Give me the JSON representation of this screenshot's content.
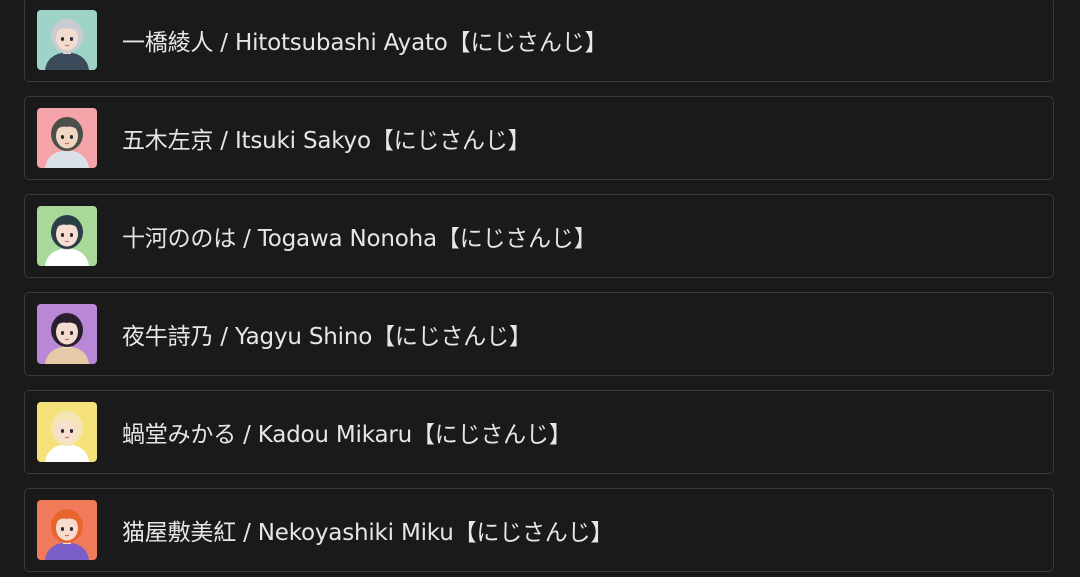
{
  "items": [
    {
      "label": "一橋綾人 / Hitotsubashi Ayato【にじさんじ】",
      "avatar": "avatar-hitotsubashi-ayato",
      "bg": "#9fd3c7",
      "hair": "#c9cdd2",
      "skin": "#f3dccd",
      "accent": "#3b4a5a"
    },
    {
      "label": "五木左京 / Itsuki Sakyo【にじさんじ】",
      "avatar": "avatar-itsuki-sakyo",
      "bg": "#f4a3a8",
      "hair": "#4a4f4a",
      "skin": "#f2d6c4",
      "accent": "#d9e0e6"
    },
    {
      "label": "十河ののは / Togawa Nonoha【にじさんじ】",
      "avatar": "avatar-togawa-nonoha",
      "bg": "#a8d89a",
      "hair": "#2c3e45",
      "skin": "#f6dfd2",
      "accent": "#ffffff"
    },
    {
      "label": "夜牛詩乃 / Yagyu Shino【にじさんじ】",
      "avatar": "avatar-yagyu-shino",
      "bg": "#b887d6",
      "hair": "#2a1f2e",
      "skin": "#f5dccf",
      "accent": "#e6c9a6"
    },
    {
      "label": "蝸堂みかる / Kadou Mikaru【にじさんじ】",
      "avatar": "avatar-kadou-mikaru",
      "bg": "#f6e27a",
      "hair": "#f3e6b3",
      "skin": "#f8e0cf",
      "accent": "#ffffff"
    },
    {
      "label": "猫屋敷美紅 / Nekoyashiki Miku【にじさんじ】",
      "avatar": "avatar-nekoyashiki-miku",
      "bg": "#f07a5a",
      "hair": "#e8652e",
      "skin": "#f7dccd",
      "accent": "#7b5fc9"
    }
  ]
}
